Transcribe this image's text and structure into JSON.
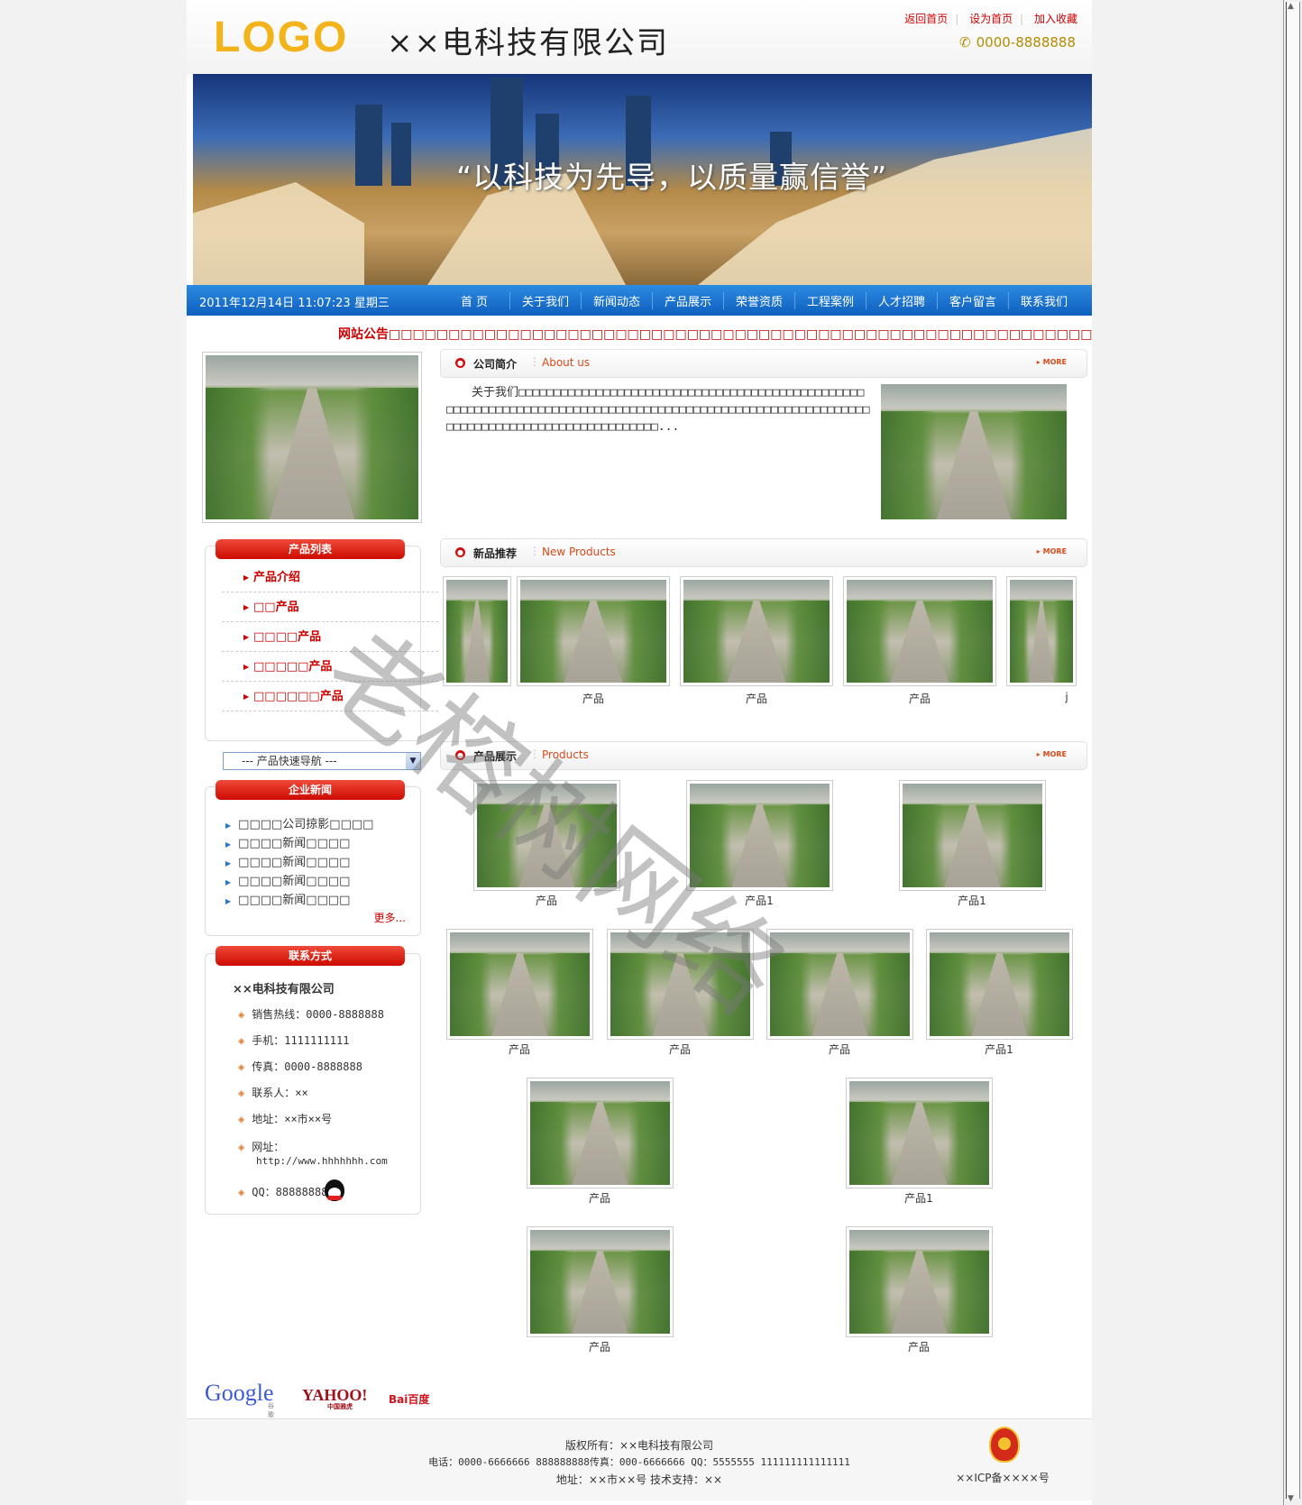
{
  "header": {
    "logo": "LOGO",
    "company": "××电科技有限公司",
    "links": [
      "返回首页",
      "设为首页",
      "加入收藏"
    ],
    "phone": "0000-8888888"
  },
  "banner": {
    "slogan": "“以科技为先导，以质量赢信誉”"
  },
  "nav": {
    "datetime": "2011年12月14日 11:07:23 星期三",
    "items": [
      "首 页",
      "关于我们",
      "新闻动态",
      "产品展示",
      "荣誉资质",
      "工程案例",
      "人才招聘",
      "客户留言",
      "联系我们"
    ]
  },
  "notice": "网站公告□□□□□□□□□□□□□□□□□□□□□□□□□□□□□□□□□□□□□□□□□□□□□□□□□□□□□□□□□□□",
  "about": {
    "title": "公司简介",
    "en": "About us",
    "more": "MORE",
    "text": "关于我们□□□□□□□□□□□□□□□□□□□□□□□□□□□□□□□□□□□□□□□□□□□□□□□□□□□□□□□□□□□□□□□□□□□□□□□□□□□□□□□□□□□□□□□□□□□□□□□□□□□□□□□□□□□□□□□□□□□□□□□□□□□□□□□□□□□□□□□□□□□..."
  },
  "product_list": {
    "title": "产品列表",
    "items": [
      "产品介绍",
      "□□产品",
      "□□□□产品",
      "□□□□□产品",
      "□□□□□□产品"
    ],
    "quick_nav": "--- 产品快速导航 ---"
  },
  "news": {
    "title": "企业新闻",
    "items": [
      "□□□□公司掠影□□□□",
      "□□□□新闻□□□□",
      "□□□□新闻□□□□",
      "□□□□新闻□□□□",
      "□□□□新闻□□□□"
    ],
    "more": "更多..."
  },
  "contact": {
    "title": "联系方式",
    "company": "××电科技有限公司",
    "items": [
      "销售热线：0000-8888888",
      "手机：1111111111",
      "传真：0000-8888888",
      "联系人：××",
      "地址：××市××号"
    ],
    "web_label": "网址：",
    "web_url": "http://www.hhhhhhh.com",
    "qq": "QQ：88888888"
  },
  "new_products": {
    "title": "新品推荐",
    "en": "New Products",
    "more": "MORE",
    "captions": [
      "产品",
      "产品",
      "产品",
      "j"
    ]
  },
  "products": {
    "title": "产品展示",
    "en": "Products",
    "more": "MORE",
    "row1": [
      "产品",
      "产品1",
      "产品1"
    ],
    "row2": [
      "产品",
      "产品",
      "产品",
      "产品1"
    ],
    "row3": [
      "产品",
      "产品1"
    ],
    "row4": [
      "产品",
      "产品"
    ]
  },
  "search_logos": {
    "google": "Google",
    "google_sub": "谷歌",
    "yahoo": "YAHOO!",
    "yahoo_sub": "中国雅虎",
    "baidu": "Bai百度"
  },
  "footer": {
    "line1": "版权所有：××电科技有限公司",
    "line2": "电话：0000-6666666 888888888传真：000-6666666  QQ：5555555 111111111111111",
    "line3": "地址：××市××号 技术支持：××",
    "icp": "××ICP备××××号"
  },
  "watermark": "老榕树网络"
}
